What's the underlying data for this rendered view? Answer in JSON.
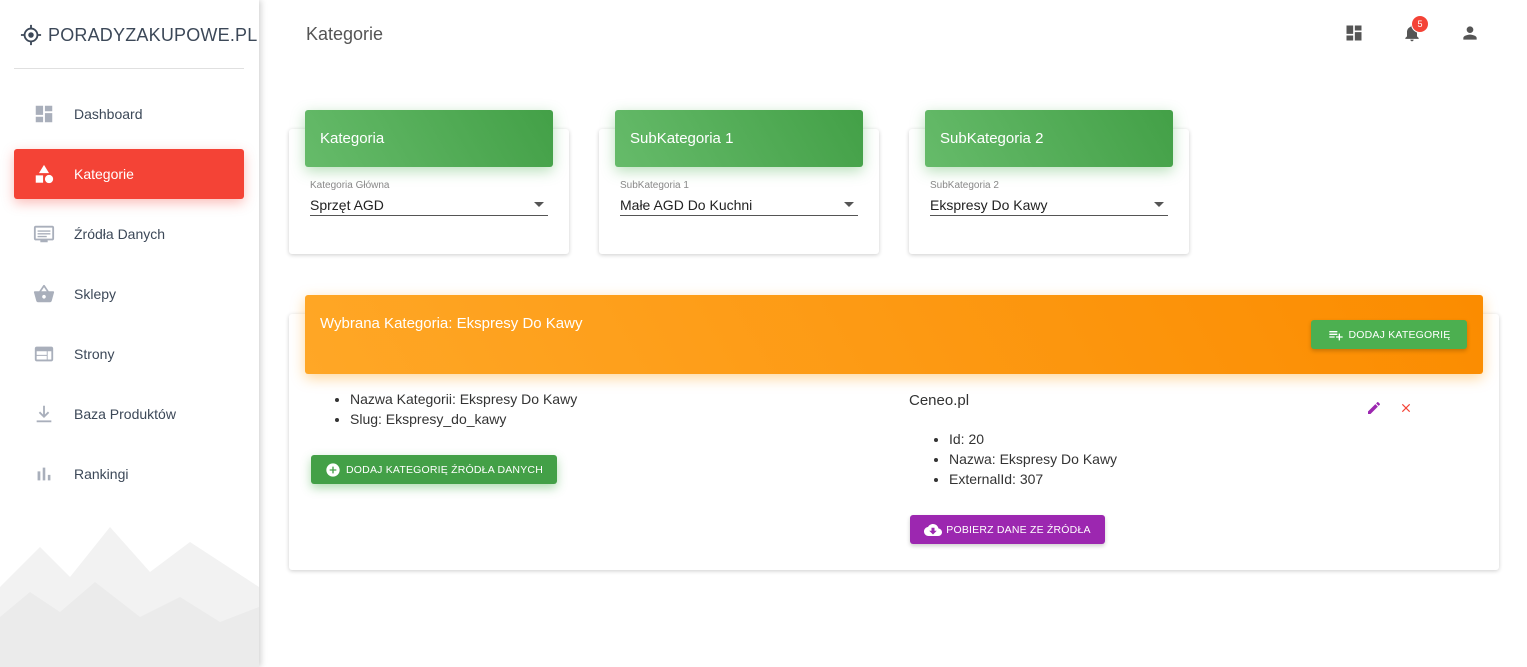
{
  "app": {
    "logo_text": "PORADYZAKUPOWE.PL",
    "page_title": "Kategorie"
  },
  "sidebar": {
    "items": [
      {
        "label": "Dashboard",
        "icon": "dashboard-icon",
        "active": false
      },
      {
        "label": "Kategorie",
        "icon": "category-icon",
        "active": true
      },
      {
        "label": "Źródła Danych",
        "icon": "data-sources-icon",
        "active": false
      },
      {
        "label": "Sklepy",
        "icon": "basket-icon",
        "active": false
      },
      {
        "label": "Strony",
        "icon": "web-icon",
        "active": false
      },
      {
        "label": "Baza Produktów",
        "icon": "download-icon",
        "active": false
      },
      {
        "label": "Rankingi",
        "icon": "bar-chart-icon",
        "active": false
      }
    ]
  },
  "topbar": {
    "notifications_count": "5",
    "icons": [
      "dashboard-icon",
      "bell-icon",
      "person-icon"
    ]
  },
  "category_cards": [
    {
      "header": "Kategoria",
      "select_label": "Kategoria Główna",
      "select_value": "Sprzęt AGD"
    },
    {
      "header": "SubKategoria 1",
      "select_label": "SubKategoria 1",
      "select_value": "Małe AGD Do Kuchni"
    },
    {
      "header": "SubKategoria 2",
      "select_label": "SubKategoria 2",
      "select_value": "Ekspresy Do Kawy"
    }
  ],
  "selected": {
    "title": "Wybrana Kategoria: Ekspresy Do Kawy",
    "add_category_button": "DODAJ KATEGORIĘ",
    "details": [
      "Nazwa Kategorii: Ekspresy Do Kawy",
      "Slug: Ekspresy_do_kawy"
    ],
    "add_source_category_button": "DODAJ KATEGORIĘ ŹRÓDŁA DANYCH",
    "source": {
      "name": "Ceneo.pl",
      "details": [
        "Id: 20",
        "Nazwa: Ekspresy Do Kawy",
        "ExternalId: 307"
      ],
      "fetch_button": "POBIERZ DANE ZE ŹRÓDŁA"
    }
  },
  "colors": {
    "active_nav": "#f44336",
    "green_header": "#4caf50",
    "orange_header": "#ff9800",
    "purple_button": "#9c27b0",
    "edit_icon": "#9c27b0",
    "delete_icon": "#f44336"
  }
}
